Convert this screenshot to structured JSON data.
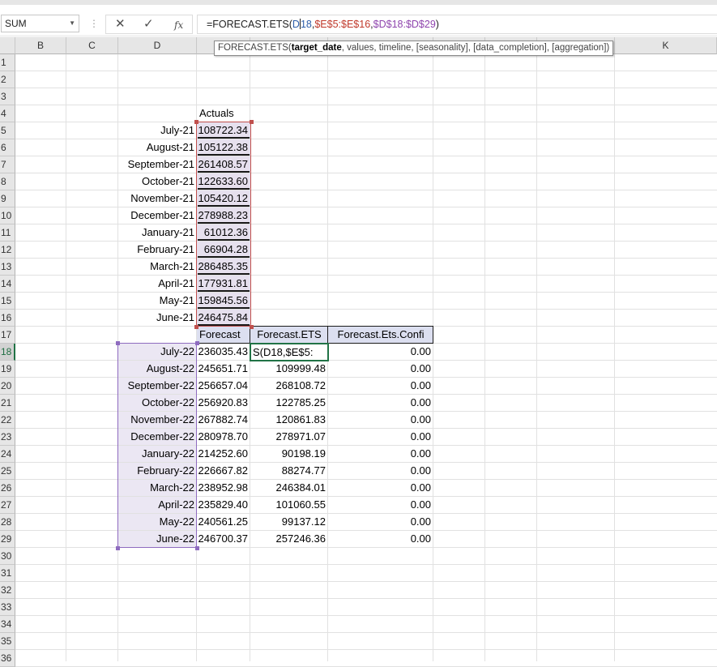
{
  "name_box": {
    "value": "SUM"
  },
  "formula_bar": {
    "prefix": "=FORECAST.ETS(",
    "arg1_a": "D",
    "arg1_b": "18",
    "sep1": ",",
    "arg2": "$E$5:$E$16",
    "sep2": ",",
    "arg3": "$D$18:$D$29",
    "suffix": ")"
  },
  "tooltip": {
    "fn": "FORECAST.ETS(",
    "bold_arg": "target_date",
    "rest": ", values, timeline, [seasonality], [data_completion], [aggregation])"
  },
  "columns": [
    "B",
    "C",
    "D",
    "",
    "",
    "",
    "",
    "",
    "",
    "K"
  ],
  "rows": [
    "1",
    "2",
    "3",
    "4",
    "5",
    "6",
    "7",
    "8",
    "9",
    "10",
    "11",
    "12",
    "13",
    "14",
    "15",
    "16",
    "17",
    "18",
    "19",
    "20",
    "21",
    "22",
    "23",
    "24",
    "25",
    "26",
    "27",
    "28",
    "29",
    "30",
    "31",
    "32",
    "33",
    "34",
    "35",
    "36"
  ],
  "actuals": {
    "header": "Actuals",
    "items": [
      {
        "date": "July-21",
        "value": "108722.34"
      },
      {
        "date": "August-21",
        "value": "105122.38"
      },
      {
        "date": "September-21",
        "value": "261408.57"
      },
      {
        "date": "October-21",
        "value": "122633.60"
      },
      {
        "date": "November-21",
        "value": "105420.12"
      },
      {
        "date": "December-21",
        "value": "278988.23"
      },
      {
        "date": "January-21",
        "value": "61012.36"
      },
      {
        "date": "February-21",
        "value": "66904.28"
      },
      {
        "date": "March-21",
        "value": "286485.35"
      },
      {
        "date": "April-21",
        "value": "177931.81"
      },
      {
        "date": "May-21",
        "value": "159845.56"
      },
      {
        "date": "June-21",
        "value": "246475.84"
      }
    ]
  },
  "forecast": {
    "headers": [
      "Forecast",
      "Forecast.ETS",
      "Forecast.Ets.Confi"
    ],
    "edit_text": "S(D18,$E$5:",
    "items": [
      {
        "date": "July-22",
        "forecast": "236035.43",
        "ets": "",
        "conf": "0.00"
      },
      {
        "date": "August-22",
        "forecast": "245651.71",
        "ets": "109999.48",
        "conf": "0.00"
      },
      {
        "date": "September-22",
        "forecast": "256657.04",
        "ets": "268108.72",
        "conf": "0.00"
      },
      {
        "date": "October-22",
        "forecast": "256920.83",
        "ets": "122785.25",
        "conf": "0.00"
      },
      {
        "date": "November-22",
        "forecast": "267882.74",
        "ets": "120861.83",
        "conf": "0.00"
      },
      {
        "date": "December-22",
        "forecast": "280978.70",
        "ets": "278971.07",
        "conf": "0.00"
      },
      {
        "date": "January-22",
        "forecast": "214252.60",
        "ets": "90198.19",
        "conf": "0.00"
      },
      {
        "date": "February-22",
        "forecast": "226667.82",
        "ets": "88274.77",
        "conf": "0.00"
      },
      {
        "date": "March-22",
        "forecast": "238952.98",
        "ets": "246384.01",
        "conf": "0.00"
      },
      {
        "date": "April-22",
        "forecast": "235829.40",
        "ets": "101060.55",
        "conf": "0.00"
      },
      {
        "date": "May-22",
        "forecast": "240561.25",
        "ets": "99137.12",
        "conf": "0.00"
      },
      {
        "date": "June-22",
        "forecast": "246700.37",
        "ets": "257246.36",
        "conf": "0.00"
      }
    ]
  },
  "colors": {
    "ref_blue": "#2f5faa",
    "ref_red": "#c0504d",
    "ref_purple": "#8e6bbf",
    "active_green": "#217346"
  }
}
